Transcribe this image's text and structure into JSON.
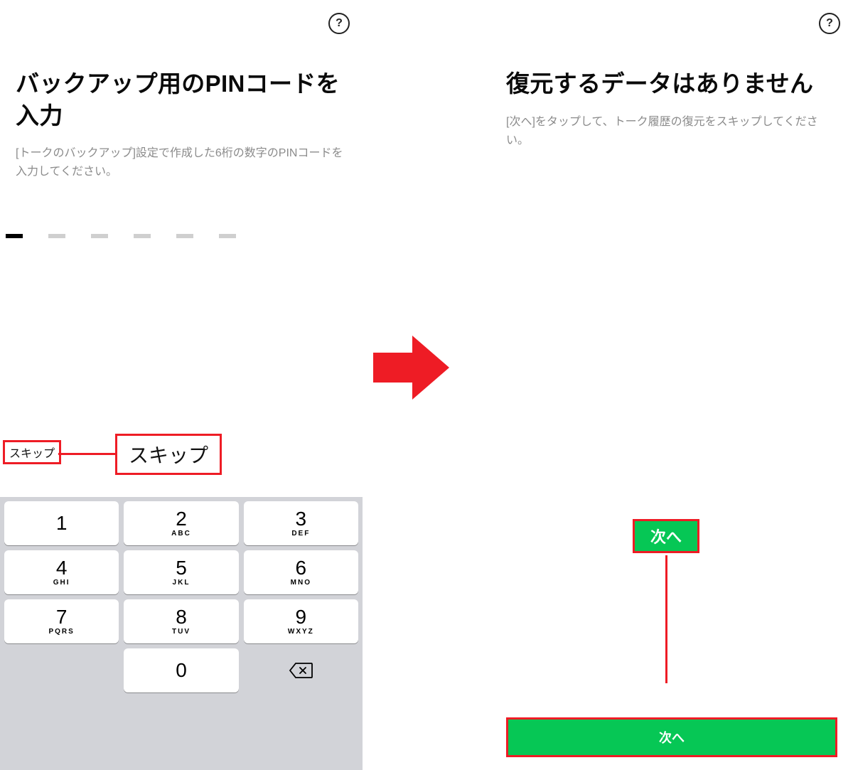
{
  "left": {
    "help_label": "?",
    "title": "バックアップ用のPINコードを入力",
    "subtext": "[トークのバックアップ]設定で作成した6桁の数字のPINコードを入力してください。",
    "skip_small": "スキップ",
    "skip_large": "スキップ",
    "keypad": {
      "keys": [
        {
          "num": "1",
          "let": ""
        },
        {
          "num": "2",
          "let": "ABC"
        },
        {
          "num": "3",
          "let": "DEF"
        },
        {
          "num": "4",
          "let": "GHI"
        },
        {
          "num": "5",
          "let": "JKL"
        },
        {
          "num": "6",
          "let": "MNO"
        },
        {
          "num": "7",
          "let": "PQRS"
        },
        {
          "num": "8",
          "let": "TUV"
        },
        {
          "num": "9",
          "let": "WXYZ"
        },
        {
          "num": "0",
          "let": ""
        }
      ]
    }
  },
  "right": {
    "help_label": "?",
    "title": "復元するデータはありません",
    "subtext": "[次へ]をタップして、トーク履歴の復元をスキップしてください。",
    "next_badge": "次へ",
    "next_button": "次へ"
  },
  "colors": {
    "accent_red": "#ee1c25",
    "brand_green": "#06c755"
  }
}
